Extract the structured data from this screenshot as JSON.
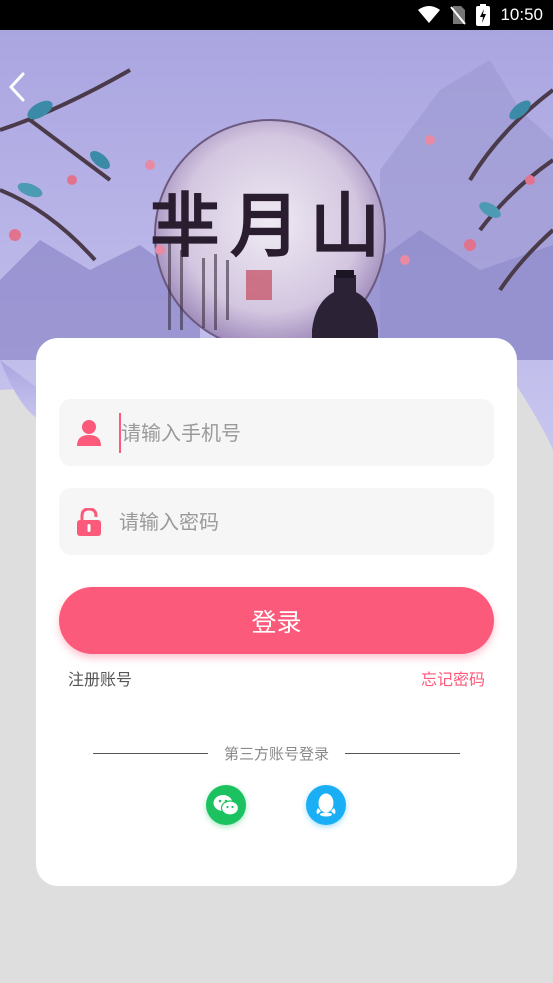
{
  "status_bar": {
    "time": "10:50",
    "icons": [
      "wifi-icon",
      "no-sim-icon",
      "battery-charging-icon"
    ]
  },
  "banner": {
    "back_icon": "chevron-left-icon",
    "logo_text": "芈月山"
  },
  "login": {
    "phone_placeholder": "请输入手机号",
    "phone_value": "",
    "password_placeholder": "请输入密码",
    "password_value": "",
    "submit_label": "登录",
    "register_link": "注册账号",
    "forgot_link": "忘记密码",
    "third_party_label": "第三方账号登录",
    "third_party": [
      {
        "name": "wechat",
        "icon": "wechat-icon"
      },
      {
        "name": "qq",
        "icon": "qq-icon"
      }
    ]
  },
  "colors": {
    "accent": "#fc5a7b",
    "banner_bg": "#b9b4e6",
    "page_bg": "#dedede",
    "wechat": "#1bc25f",
    "qq": "#1aaef5"
  }
}
